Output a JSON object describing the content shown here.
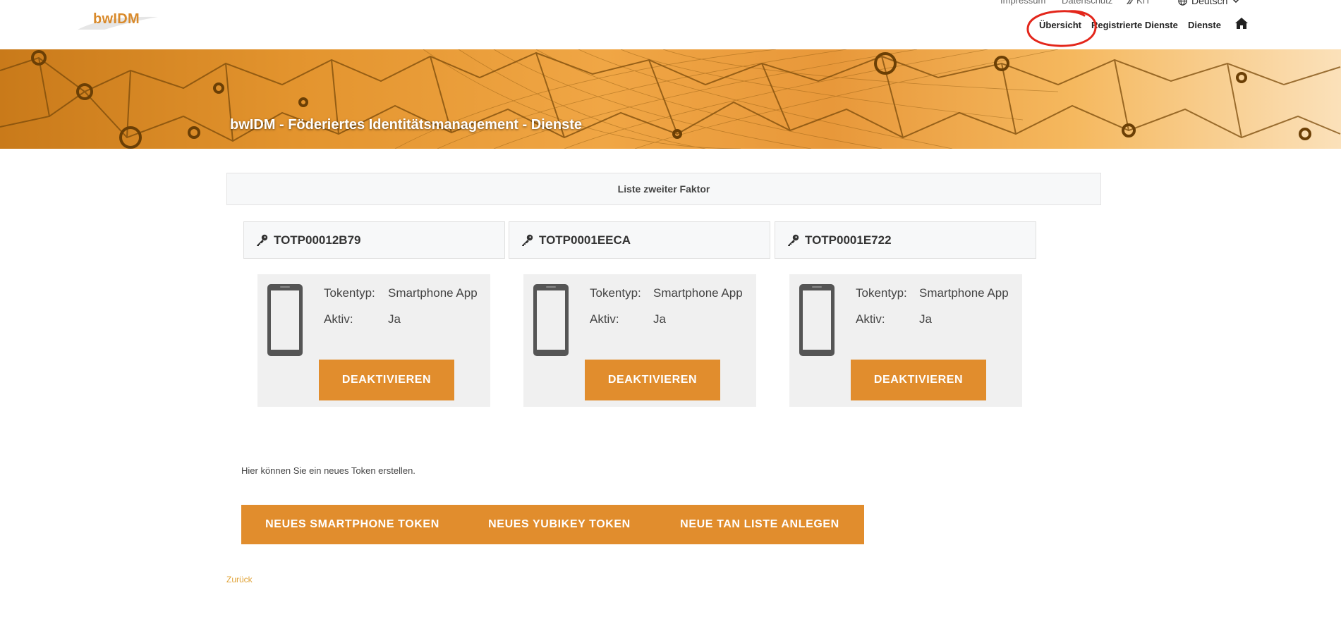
{
  "logo": {
    "text": "bwIDM"
  },
  "utility": {
    "impressum": "Impressum",
    "datenschutz": "Datenschutz",
    "kit": "KIT",
    "language": "Deutsch"
  },
  "nav": {
    "uebersicht": "Übersicht",
    "registrierte_dienste": "Registrierte Dienste",
    "dienste": "Dienste",
    "home_icon": "home-icon"
  },
  "banner": {
    "title": "bwIDM - Föderiertes Identitätsmanagement - Dienste"
  },
  "list_header": "Liste zweiter Faktor",
  "tokens": [
    {
      "id": "TOTP00012B79",
      "type_label": "Tokentyp:",
      "type_value": "Smartphone App",
      "active_label": "Aktiv:",
      "active_value": "Ja",
      "button": "DEAKTIVIEREN"
    },
    {
      "id": "TOTP0001EECA",
      "type_label": "Tokentyp:",
      "type_value": "Smartphone App",
      "active_label": "Aktiv:",
      "active_value": "Ja",
      "button": "DEAKTIVIEREN"
    },
    {
      "id": "TOTP0001E722",
      "type_label": "Tokentyp:",
      "type_value": "Smartphone App",
      "active_label": "Aktiv:",
      "active_value": "Ja",
      "button": "DEAKTIVIEREN"
    }
  ],
  "new_token_text": "Hier können Sie ein neues Token erstellen.",
  "actions": {
    "smartphone": "NEUES SMARTPHONE TOKEN",
    "yubikey": "NEUES YUBIKEY TOKEN",
    "tan": "NEUE TAN LISTE ANLEGEN"
  },
  "back_link": "Zurück",
  "colors": {
    "accent": "#e18d2d",
    "annotation": "#e3261b",
    "link": "#e0a43a"
  }
}
